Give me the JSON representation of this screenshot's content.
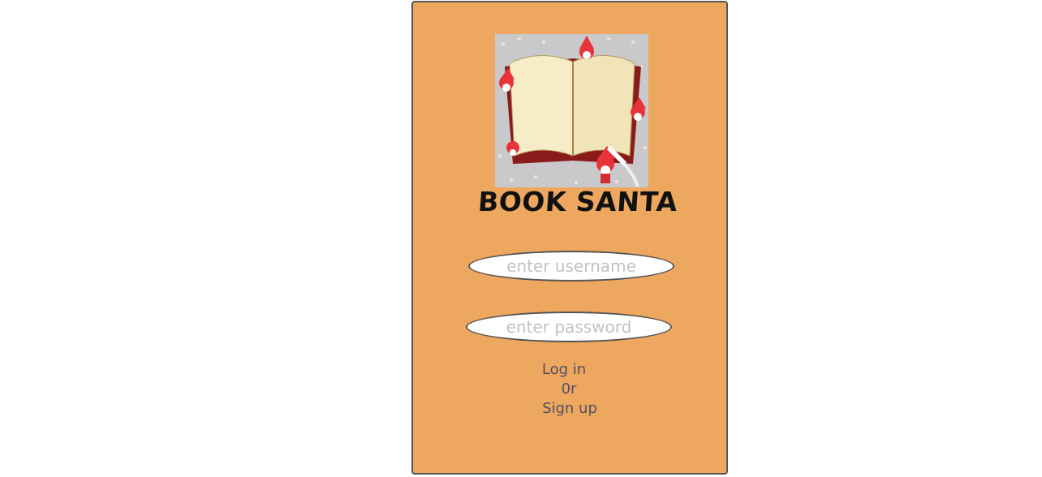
{
  "app": {
    "title": "BOOK SANTA"
  },
  "logo": {
    "icon": "open-book-with-santas-illustration"
  },
  "form": {
    "username_placeholder": "enter username",
    "username_value": "",
    "password_placeholder": "enter password",
    "password_value": ""
  },
  "actions": {
    "login_label": "Log in",
    "or_text": "0r",
    "signup_label": "Sign up"
  },
  "colors": {
    "card_background": "#eea75e",
    "card_border": "#555555",
    "link_text": "#4f4f66",
    "title_text": "#111111"
  }
}
